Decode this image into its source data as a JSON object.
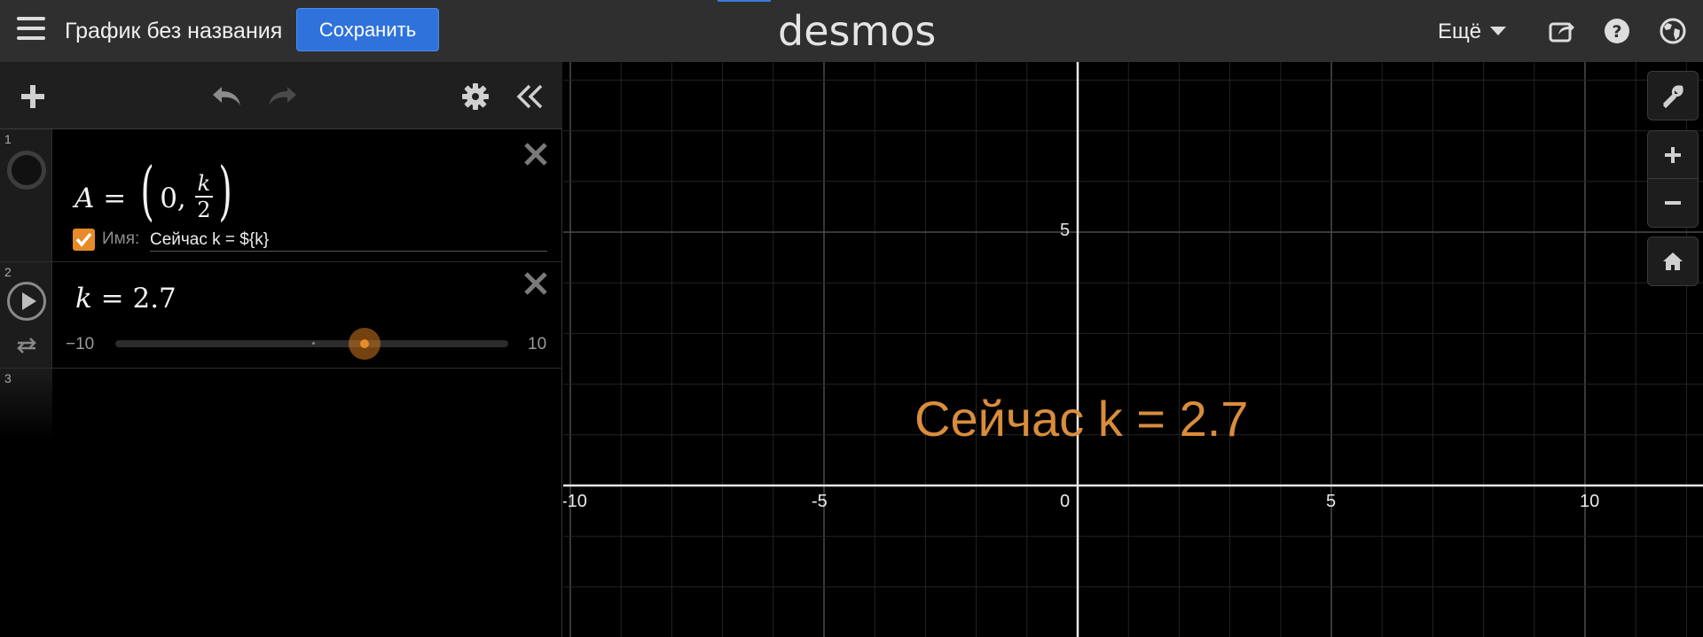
{
  "header": {
    "graph_title": "График без названия",
    "save_label": "Сохранить",
    "brand": "desmos",
    "more_label": "Ещё"
  },
  "expressions": [
    {
      "index": "1",
      "latex": "A=\\left(0,\\frac{k}{2}\\right)",
      "show_label": true,
      "label_caption": "Имя:",
      "label_text": "Сейчас k = ${k}"
    },
    {
      "index": "2",
      "latex": "k=2.7",
      "slider": {
        "min_label": "−10",
        "max_label": "10",
        "min": -10,
        "max": 10,
        "value": 2.7
      }
    },
    {
      "index": "3",
      "latex": ""
    }
  ],
  "graph": {
    "x_ticks": [
      "-10",
      "-5",
      "0",
      "5",
      "10"
    ],
    "y_ticks": [
      "5"
    ],
    "point_label": "Сейчас k = 2.7",
    "point_color": "#d98d3c"
  },
  "colors": {
    "accent": "#e78b28",
    "save_button": "#2f72dc",
    "header_bg": "#2f2f2f"
  }
}
